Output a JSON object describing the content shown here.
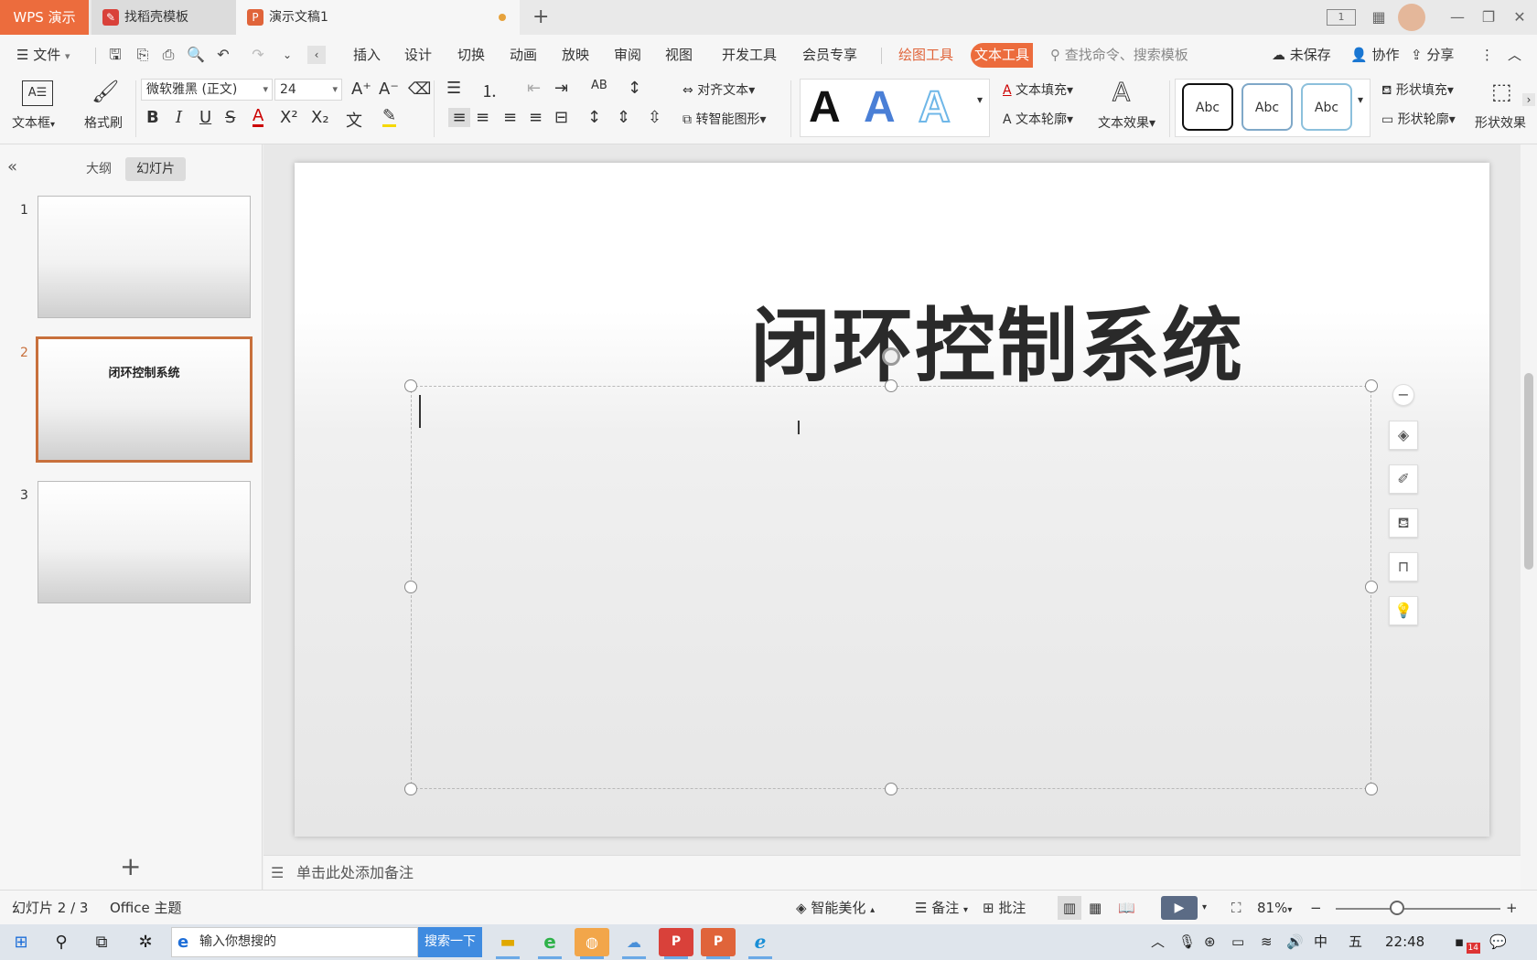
{
  "tabbar": {
    "app_name": "WPS 演示",
    "tabs": [
      {
        "label": "找稻壳模板"
      },
      {
        "label": "演示文稿1"
      }
    ],
    "window_badge": "1"
  },
  "menubar": {
    "file_label": "文件",
    "items": [
      "插入",
      "设计",
      "切换",
      "动画",
      "放映",
      "审阅",
      "视图",
      "开发工具",
      "会员专享"
    ],
    "drawing_tools": "绘图工具",
    "text_tools": "文本工具",
    "search_placeholder": "查找命令、搜索模板",
    "unsaved": "未保存",
    "collaborate": "协作",
    "share": "分享"
  },
  "ribbon": {
    "textbox_label": "文本框",
    "format_painter_label": "格式刷",
    "font_name": "微软雅黑 (正文)",
    "font_size": "24",
    "align_text": "对齐文本",
    "smart_shape": "转智能图形",
    "text_fill": "文本填充",
    "text_outline": "文本轮廓",
    "text_effect": "文本效果",
    "shape_fill": "形状填充",
    "shape_outline": "形状轮廓",
    "shape_effect": "形状效果",
    "style_sample": "A",
    "abc_samples": [
      "Abc",
      "Abc",
      "Abc"
    ],
    "colors": {
      "style_black": "#111111",
      "style_blue": "#4a7fd6",
      "style_lightblue": "#6fb7e8"
    }
  },
  "left_panel": {
    "tabs": [
      "大纲",
      "幻灯片"
    ],
    "active_tab": "幻灯片",
    "slides": [
      {
        "number": "1",
        "title": ""
      },
      {
        "number": "2",
        "title": "闭环控制系统"
      },
      {
        "number": "3",
        "title": ""
      }
    ],
    "selected_slide": "2"
  },
  "slide": {
    "title": "闭环控制系统"
  },
  "notes": {
    "placeholder": "单击此处添加备注"
  },
  "statusbar": {
    "slide_counter": "幻灯片 2 / 3",
    "theme": "Office 主题",
    "smart_beautify": "智能美化",
    "notes_label": "备注",
    "comments_label": "批注",
    "zoom": "81%"
  },
  "taskbar": {
    "search_text": "输入你想搜的",
    "search_button": "搜索一下",
    "ime_lang": "中",
    "ime_mode": "五",
    "time": "22:48",
    "notification_count": "14"
  },
  "accent_color": "#ec6c3d"
}
